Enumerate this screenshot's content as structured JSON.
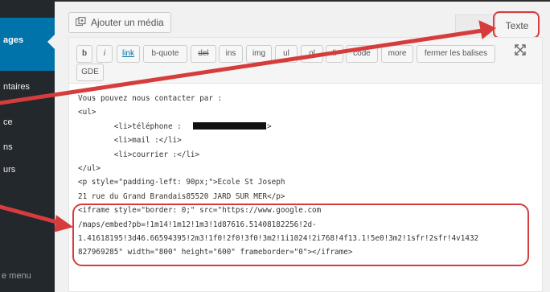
{
  "sidebar": {
    "items": [
      {
        "label": "ages"
      },
      {
        "label": "ntaires"
      },
      {
        "label": "ce"
      },
      {
        "label": "ns"
      },
      {
        "label": "urs"
      },
      {
        "label": "e menu"
      }
    ]
  },
  "toolbar": {
    "add_media_label": "Ajouter un média",
    "tab_text_label": "Texte",
    "buttons": [
      "b",
      "i",
      "link",
      "b-quote",
      "del",
      "ins",
      "img",
      "ul",
      "ol",
      "li",
      "code",
      "more",
      "fermer les balises",
      "GDE"
    ]
  },
  "editor": {
    "lines": [
      "Vous pouvez nous contacter par :",
      "<ul>",
      "        <li>téléphone :               </li>",
      "        <li>mail :</li>",
      "        <li>courrier :</li>",
      "</ul>",
      "<p style=\"padding-left: 90px;\">Ecole St Joseph",
      "21 rue du Grand Brandais85520 JARD SUR MER</p>",
      "<iframe style=\"border: 0;\" src=\"https://www.google.com",
      "/maps/embed?pb=!1m14!1m12!1m3!1d87616.51408182256!2d-",
      "1.41618195!3d46.66594395!2m3!1f0!2f0!3f0!3m2!1i1024!2i768!4f13.1!5e0!3m2!1sfr!2sfr!4v1432",
      "827969285\" width=\"800\" height=\"600\" frameborder=\"0\"></iframe>"
    ]
  },
  "colors": {
    "annotation_red": "#d63c3c",
    "sidebar_bg": "#23282d",
    "sidebar_active": "#0073aa"
  }
}
